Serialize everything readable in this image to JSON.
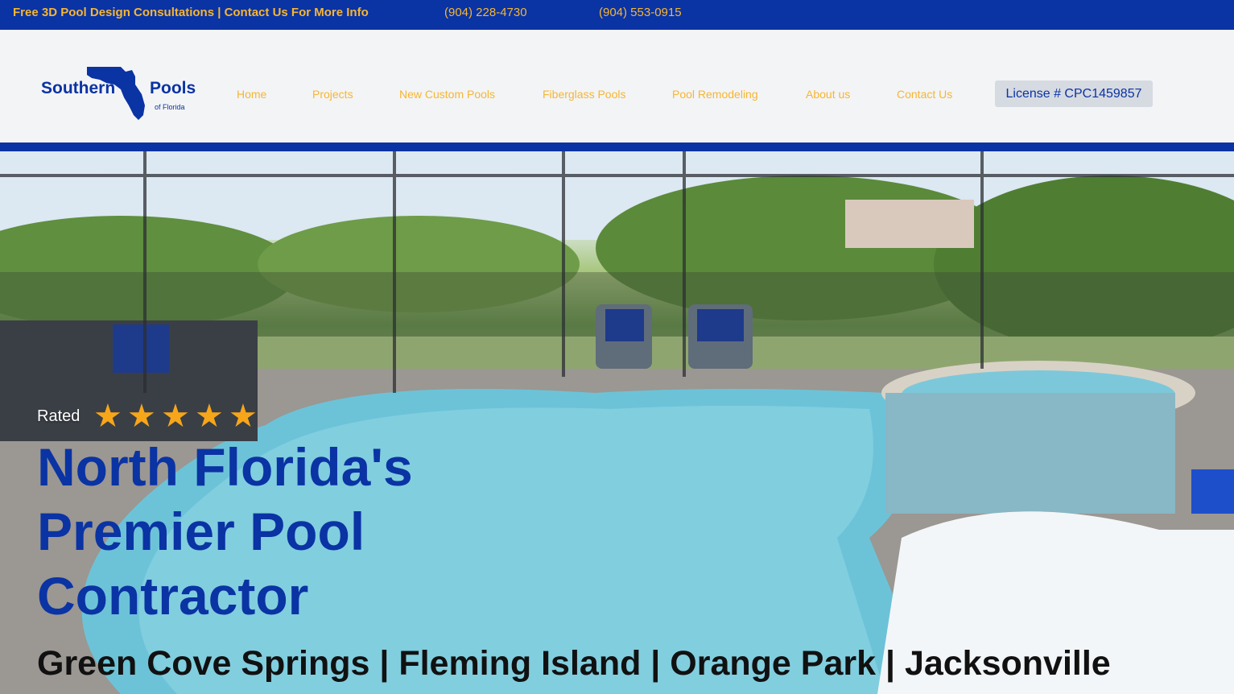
{
  "topbar": {
    "promo": "Free 3D Pool Design Consultations | Contact Us For More Info",
    "phone1": "(904) 228-4730",
    "phone2": "(904) 553-0915"
  },
  "logo": {
    "word1": "Southern",
    "word2": "Pools",
    "sub": "of Florida"
  },
  "nav": [
    {
      "label": "Home"
    },
    {
      "label": "Projects"
    },
    {
      "label": "New Custom Pools"
    },
    {
      "label": "Fiberglass Pools"
    },
    {
      "label": "Pool Remodeling"
    },
    {
      "label": "About us"
    },
    {
      "label": "Contact Us"
    }
  ],
  "license": "License # CPC1459857",
  "hero": {
    "rated": "Rated",
    "stars": 5,
    "headline": "North Florida's Premier Pool Contractor",
    "areas": "Green Cove Springs | Fleming Island | Orange Park | Jacksonville"
  },
  "colors": {
    "brand_blue": "#0a33a4",
    "accent_gold": "#f6b631",
    "star": "#f7a61a"
  }
}
